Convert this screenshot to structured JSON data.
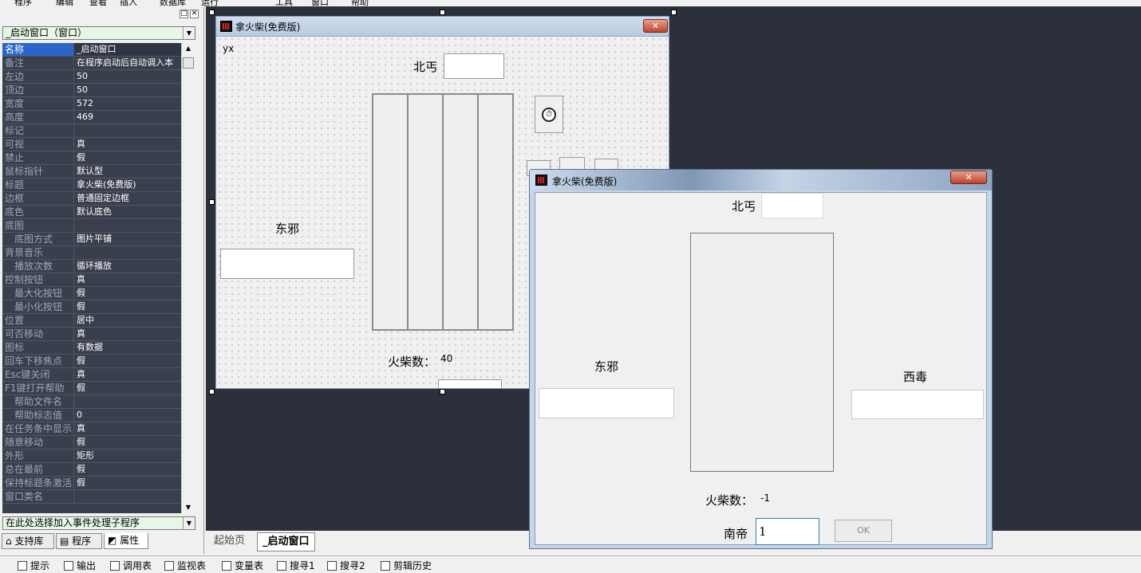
{
  "menubar": {
    "items": [
      "程序",
      "编辑",
      "查看",
      "插入",
      "数据库",
      "运行",
      "工具",
      "窗口",
      "帮助"
    ]
  },
  "left_panel": {
    "object_combo": "_启动窗口（窗口）",
    "event_combo": "在此处选择加入事件处理子程序",
    "properties": [
      {
        "name": "名称",
        "value": "_启动窗口",
        "selected": true
      },
      {
        "name": "备注",
        "value": "在程序启动后自动调入本"
      },
      {
        "name": "左边",
        "value": "50"
      },
      {
        "name": "顶边",
        "value": "50"
      },
      {
        "name": "宽度",
        "value": "572"
      },
      {
        "name": "高度",
        "value": "469"
      },
      {
        "name": "标记",
        "value": ""
      },
      {
        "name": "可视",
        "value": "真"
      },
      {
        "name": "禁止",
        "value": "假"
      },
      {
        "name": "鼠标指针",
        "value": "默认型"
      },
      {
        "name": "标题",
        "value": "拿火柴(免费版)"
      },
      {
        "name": "边框",
        "value": "普通固定边框"
      },
      {
        "name": "底色",
        "value": "默认底色"
      },
      {
        "name": "底图",
        "value": ""
      },
      {
        "name": "底图方式",
        "value": "图片平铺",
        "indent": true
      },
      {
        "name": "背景音乐",
        "value": ""
      },
      {
        "name": "播放次数",
        "value": "循环播放",
        "indent": true
      },
      {
        "name": "控制按钮",
        "value": "真"
      },
      {
        "name": "最大化按钮",
        "value": "假",
        "indent": true
      },
      {
        "name": "最小化按钮",
        "value": "假",
        "indent": true
      },
      {
        "name": "位置",
        "value": "居中"
      },
      {
        "name": "可否移动",
        "value": "真"
      },
      {
        "name": "图标",
        "value": "有数据"
      },
      {
        "name": "回车下移焦点",
        "value": "假"
      },
      {
        "name": "Esc键关闭",
        "value": "真"
      },
      {
        "name": "F1键打开帮助",
        "value": "假"
      },
      {
        "name": "帮助文件名",
        "value": "",
        "indent": true
      },
      {
        "name": "帮助标志值",
        "value": "0",
        "indent": true
      },
      {
        "name": "在任务条中显示",
        "value": "真"
      },
      {
        "name": "随意移动",
        "value": "假"
      },
      {
        "name": "外形",
        "value": "矩形"
      },
      {
        "name": "总在最前",
        "value": "假"
      },
      {
        "name": "保持标题条激活",
        "value": "假"
      },
      {
        "name": "窗口类名",
        "value": ""
      }
    ],
    "tabs": [
      "支持库",
      "程序",
      "属性"
    ]
  },
  "design_form": {
    "title": "拿火柴(免费版)",
    "close": "✕",
    "corner_label": "yx",
    "north_label": "北丐",
    "east_label": "东邪",
    "matches_label": "火柴数：",
    "matches_value": "40"
  },
  "runtime_window": {
    "title": "拿火柴(免费版)",
    "close": "✕",
    "north_label": "北丐",
    "east_label": "东邪",
    "west_label": "西毒",
    "matches_label": "火柴数：",
    "matches_value": "-1",
    "south_label": "南帝",
    "south_input_value": "1",
    "ok_button": "OK"
  },
  "editor_tabs": [
    "起始页",
    "_启动窗口"
  ],
  "bottom_bar": [
    "提示",
    "输出",
    "调用表",
    "监视表",
    "变量表",
    "搜寻1",
    "搜寻2",
    "剪辑历史"
  ],
  "colors": {
    "design_bg": "#2b303b",
    "property_bg": "#3a3f4d",
    "selection": "#2a66c9",
    "combo_bg": "#e7f7e7"
  }
}
